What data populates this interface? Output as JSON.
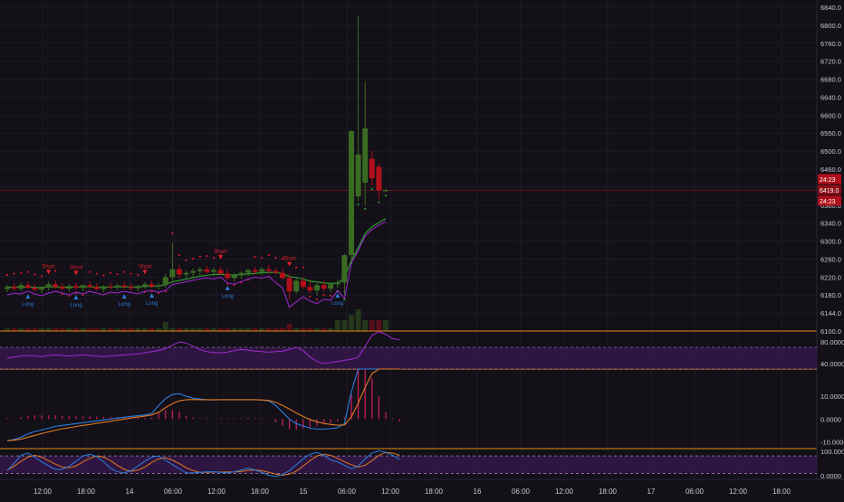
{
  "colors": {
    "background": "#131018",
    "grid": "#1e1a26",
    "axis_text": "#c8c8d0",
    "up": "#3a6b22",
    "down": "#b0101a",
    "pane_separator": "#e08a10",
    "price_line": "#8a1a1a",
    "signal_long": "#2a7bd4",
    "signal_short": "#e0202a",
    "psar": "#d01828",
    "ma_green": "#2f9a2f",
    "purple": "#a02ad0",
    "rsi_band": "#3a1850",
    "macd_line": "#2a80e0",
    "signal_line": "#e07820",
    "hist_color": "#c0205a"
  },
  "chart_data": [
    {
      "type": "candlestick",
      "pane": "price",
      "ylim": [
        6100,
        6850
      ],
      "y_ticks": [
        "6840.0",
        "6800.0",
        "6760.0",
        "6720.0",
        "6680.0",
        "6640.0",
        "6600.0",
        "6550.0",
        "6500.0",
        "6460.0",
        "6419.0",
        "6380.0",
        "6340.0",
        "6300.0",
        "6260.0",
        "6220.0",
        "6180.0",
        "6144.0",
        "6100.0"
      ],
      "price_badges": [
        "24:23",
        "6419.0",
        "24:23"
      ],
      "last_price": 6419,
      "x_tick_labels": [
        "12:00",
        "18:00",
        "14",
        "06:00",
        "12:00",
        "18:00",
        "15",
        "06:00",
        "12:00",
        "18:00",
        "16",
        "06:00",
        "12:00",
        "18:00",
        "17",
        "06:00",
        "12:00",
        "18:00"
      ],
      "candles": [
        {
          "o": 6195,
          "h": 6205,
          "l": 6188,
          "c": 6200
        },
        {
          "o": 6200,
          "h": 6208,
          "l": 6192,
          "c": 6196
        },
        {
          "o": 6196,
          "h": 6210,
          "l": 6190,
          "c": 6204
        },
        {
          "o": 6204,
          "h": 6212,
          "l": 6196,
          "c": 6198
        },
        {
          "o": 6198,
          "h": 6206,
          "l": 6190,
          "c": 6194
        },
        {
          "o": 6194,
          "h": 6202,
          "l": 6186,
          "c": 6199
        },
        {
          "o": 6199,
          "h": 6212,
          "l": 6192,
          "c": 6206
        },
        {
          "o": 6206,
          "h": 6214,
          "l": 6196,
          "c": 6200
        },
        {
          "o": 6200,
          "h": 6208,
          "l": 6192,
          "c": 6196
        },
        {
          "o": 6196,
          "h": 6206,
          "l": 6188,
          "c": 6202
        },
        {
          "o": 6202,
          "h": 6210,
          "l": 6194,
          "c": 6198
        },
        {
          "o": 6198,
          "h": 6206,
          "l": 6190,
          "c": 6204
        },
        {
          "o": 6204,
          "h": 6212,
          "l": 6196,
          "c": 6200
        },
        {
          "o": 6200,
          "h": 6208,
          "l": 6192,
          "c": 6195
        },
        {
          "o": 6195,
          "h": 6204,
          "l": 6188,
          "c": 6201
        },
        {
          "o": 6201,
          "h": 6210,
          "l": 6194,
          "c": 6199
        },
        {
          "o": 6199,
          "h": 6207,
          "l": 6192,
          "c": 6203
        },
        {
          "o": 6203,
          "h": 6212,
          "l": 6196,
          "c": 6200
        },
        {
          "o": 6200,
          "h": 6208,
          "l": 6193,
          "c": 6197
        },
        {
          "o": 6197,
          "h": 6205,
          "l": 6190,
          "c": 6202
        },
        {
          "o": 6202,
          "h": 6212,
          "l": 6196,
          "c": 6206
        },
        {
          "o": 6206,
          "h": 6214,
          "l": 6198,
          "c": 6201
        },
        {
          "o": 6201,
          "h": 6210,
          "l": 6194,
          "c": 6204
        },
        {
          "o": 6204,
          "h": 6230,
          "l": 6198,
          "c": 6222
        },
        {
          "o": 6222,
          "h": 6300,
          "l": 6214,
          "c": 6240
        },
        {
          "o": 6240,
          "h": 6250,
          "l": 6220,
          "c": 6228
        },
        {
          "o": 6228,
          "h": 6238,
          "l": 6218,
          "c": 6232
        },
        {
          "o": 6232,
          "h": 6242,
          "l": 6222,
          "c": 6236
        },
        {
          "o": 6236,
          "h": 6246,
          "l": 6226,
          "c": 6240
        },
        {
          "o": 6240,
          "h": 6248,
          "l": 6230,
          "c": 6234
        },
        {
          "o": 6234,
          "h": 6244,
          "l": 6224,
          "c": 6238
        },
        {
          "o": 6238,
          "h": 6246,
          "l": 6228,
          "c": 6230
        },
        {
          "o": 6230,
          "h": 6240,
          "l": 6215,
          "c": 6220
        },
        {
          "o": 6220,
          "h": 6232,
          "l": 6212,
          "c": 6226
        },
        {
          "o": 6226,
          "h": 6236,
          "l": 6218,
          "c": 6232
        },
        {
          "o": 6232,
          "h": 6242,
          "l": 6224,
          "c": 6238
        },
        {
          "o": 6238,
          "h": 6246,
          "l": 6228,
          "c": 6234
        },
        {
          "o": 6234,
          "h": 6244,
          "l": 6226,
          "c": 6240
        },
        {
          "o": 6240,
          "h": 6250,
          "l": 6230,
          "c": 6236
        },
        {
          "o": 6236,
          "h": 6244,
          "l": 6228,
          "c": 6232
        },
        {
          "o": 6232,
          "h": 6242,
          "l": 6216,
          "c": 6220
        },
        {
          "o": 6220,
          "h": 6230,
          "l": 6172,
          "c": 6190
        },
        {
          "o": 6190,
          "h": 6222,
          "l": 6184,
          "c": 6214
        },
        {
          "o": 6214,
          "h": 6222,
          "l": 6196,
          "c": 6200
        },
        {
          "o": 6200,
          "h": 6212,
          "l": 6186,
          "c": 6192
        },
        {
          "o": 6192,
          "h": 6208,
          "l": 6180,
          "c": 6204
        },
        {
          "o": 6204,
          "h": 6214,
          "l": 6190,
          "c": 6196
        },
        {
          "o": 6196,
          "h": 6210,
          "l": 6188,
          "c": 6206
        },
        {
          "o": 6206,
          "h": 6216,
          "l": 6198,
          "c": 6210
        },
        {
          "o": 6210,
          "h": 6275,
          "l": 6180,
          "c": 6272
        },
        {
          "o": 6272,
          "h": 6556,
          "l": 6262,
          "c": 6553
        },
        {
          "o": 6405,
          "h": 6815,
          "l": 6395,
          "c": 6500
        },
        {
          "o": 6436,
          "h": 6666,
          "l": 6385,
          "c": 6559
        },
        {
          "o": 6490,
          "h": 6508,
          "l": 6430,
          "c": 6446
        },
        {
          "o": 6472,
          "h": 6480,
          "l": 6400,
          "c": 6418
        },
        {
          "o": 6419,
          "h": 6422,
          "l": 6415,
          "c": 6419
        }
      ],
      "short_signals": [
        6,
        10,
        20,
        31,
        41
      ],
      "long_signals": [
        3,
        10,
        17,
        21,
        32,
        48
      ],
      "signal_labels": {
        "long": "Long",
        "short": "Short"
      }
    },
    {
      "type": "line",
      "pane": "oscillator",
      "ylim": [
        30,
        100
      ],
      "y_ticks": [
        "80.0000",
        "40.0000"
      ],
      "levels": [
        70,
        30
      ],
      "values": [
        50,
        52,
        54,
        55,
        54,
        53,
        55,
        56,
        55,
        54,
        55,
        56,
        55,
        54,
        53,
        54,
        55,
        56,
        57,
        58,
        60,
        62,
        64,
        68,
        74,
        80,
        78,
        72,
        66,
        62,
        60,
        60,
        61,
        64,
        66,
        65,
        63,
        62,
        61,
        62,
        63,
        66,
        70,
        64,
        52,
        44,
        40,
        42,
        44,
        46,
        48,
        52,
        72,
        92,
        99,
        94,
        86,
        84
      ]
    },
    {
      "type": "line",
      "pane": "macd",
      "ylim": [
        -13,
        22
      ],
      "y_ticks": [
        "10.0000",
        "0.0000",
        "-10.0000"
      ],
      "series_macd": [
        -9.5,
        -9,
        -8,
        -6.5,
        -5.5,
        -4.8,
        -4,
        -3.2,
        -2.8,
        -2.4,
        -2,
        -1.6,
        -1.2,
        -0.8,
        -0.4,
        0,
        0.4,
        0.8,
        1.2,
        1.5,
        1.8,
        2.5,
        6,
        9,
        10.8,
        11.2,
        10,
        9.2,
        8.8,
        8.5,
        8.4,
        8.5,
        8.5,
        8.5,
        8.5,
        8.5,
        8.5,
        8.4,
        8,
        6,
        3,
        0,
        -2,
        -3,
        -4,
        -4.4,
        -4.4,
        -4.2,
        -3.8,
        -2,
        12,
        30,
        40,
        38,
        34,
        30,
        28,
        27
      ],
      "series_signal": [
        -9.5,
        -9.3,
        -8.8,
        -8,
        -7.2,
        -6.4,
        -5.6,
        -4.9,
        -4.3,
        -3.8,
        -3.3,
        -2.8,
        -2.4,
        -1.9,
        -1.4,
        -1,
        -0.5,
        0,
        0.5,
        0.9,
        1.3,
        1.8,
        3,
        5,
        6.8,
        8,
        8.5,
        8.6,
        8.5,
        8.5,
        8.5,
        8.5,
        8.5,
        8.5,
        8.5,
        8.5,
        8.5,
        8.4,
        8.2,
        7.4,
        6,
        4.4,
        2.7,
        1.1,
        -0.2,
        -1.2,
        -1.9,
        -2.4,
        -2.7,
        -2.6,
        1,
        7,
        14,
        20,
        24,
        27,
        28,
        28
      ],
      "histogram": [
        0,
        0.3,
        0.8,
        1.5,
        1.7,
        1.6,
        1.6,
        1.7,
        1.5,
        1.4,
        1.3,
        1.2,
        1.2,
        1.1,
        1,
        1,
        0.9,
        0.8,
        0.7,
        0.6,
        0.5,
        0.7,
        3,
        4,
        4,
        3.2,
        1.5,
        0.6,
        0.3,
        0,
        -0.1,
        0,
        0,
        0,
        0,
        0,
        0,
        0,
        -0.2,
        -1.4,
        -3,
        -4.4,
        -4.7,
        -4.1,
        -3.8,
        -3.2,
        -2.5,
        -1.8,
        -1.1,
        0.6,
        11,
        23,
        26,
        18,
        10,
        3,
        0,
        -1
      ]
    },
    {
      "type": "line",
      "pane": "stochastic",
      "ylim": [
        0,
        105
      ],
      "y_ticks": [
        "100.0000",
        "0.0000"
      ],
      "levels": [
        80,
        20
      ],
      "series_k": [
        30,
        55,
        82,
        90,
        76,
        60,
        46,
        34,
        34,
        45,
        62,
        80,
        86,
        78,
        60,
        38,
        26,
        22,
        30,
        46,
        62,
        76,
        80,
        66,
        50,
        36,
        22,
        22,
        24,
        26,
        26,
        24,
        22,
        26,
        32,
        38,
        32,
        24,
        14,
        10,
        16,
        30,
        50,
        70,
        86,
        92,
        82,
        66,
        60,
        48,
        36,
        46,
        70,
        90,
        98,
        92,
        82,
        68
      ],
      "series_d": [
        32,
        45,
        62,
        76,
        82,
        76,
        64,
        52,
        42,
        40,
        46,
        60,
        72,
        80,
        76,
        64,
        48,
        34,
        28,
        32,
        42,
        58,
        70,
        74,
        66,
        54,
        40,
        30,
        24,
        24,
        25,
        25,
        25,
        25,
        27,
        31,
        32,
        30,
        24,
        18,
        14,
        18,
        28,
        46,
        64,
        80,
        86,
        82,
        72,
        60,
        50,
        42,
        48,
        64,
        82,
        92,
        90,
        82
      ]
    }
  ]
}
